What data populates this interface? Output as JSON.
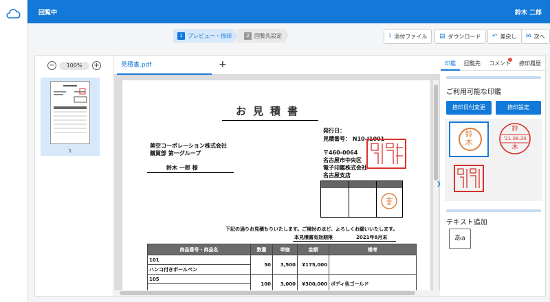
{
  "app": {
    "status_title": "回覧中",
    "user_name": "鈴木 二郎"
  },
  "steps": [
    {
      "num": "1",
      "label": "プレビュー・捺印"
    },
    {
      "num": "2",
      "label": "回覧先設定"
    }
  ],
  "toolbar": {
    "attach": "添付ファイル",
    "download": "ダウンロード",
    "return": "差戻し",
    "next": "次へ"
  },
  "thumbs": {
    "zoom": "100%",
    "page_num": "1"
  },
  "file_tab": "見積書.pdf",
  "document": {
    "title": "お見積書",
    "issue_date": "発行日：",
    "estimate_no": "見積番号： N10-J1001",
    "customer_company": "美空コーポレーション株式会社",
    "customer_dept": "購買部 第一グループ",
    "customer_person": "鈴木 一郎 様",
    "postal": "〒460-0064",
    "address": "名古屋市中央区",
    "vendor_company": "電子印鑑株式会社",
    "vendor_branch": "名古屋支店",
    "intro": "下記の通りお見積もりいたします。ご検討のほど、よろしくお願いいたします。",
    "validity_label": "本見積書有効期限",
    "validity_date": "2021年8月末",
    "table": {
      "headers": [
        "商品番号・商品名",
        "数量",
        "単価",
        "金額",
        "備考"
      ],
      "rows": [
        {
          "code": "101",
          "name": "ハンコ付きボールペン",
          "qty": "50",
          "price": "3,500",
          "amount": "¥175,000",
          "note": ""
        },
        {
          "code": "105",
          "name": "",
          "qty": "100",
          "price": "3,000",
          "amount": "¥300,000",
          "note": "ボディ色ゴールド"
        }
      ]
    }
  },
  "right_panel": {
    "tabs": [
      "印鑑",
      "回覧先",
      "コメント",
      "捺印履歴"
    ],
    "available_title": "ご利用可能な印鑑",
    "date_btn": "捺印日付変更",
    "setting_btn": "捺印設定",
    "stamp_date": "'21.08.20",
    "stamp_surname": "鈴",
    "stamp_given": "木",
    "text_add": "テキスト追加",
    "text_icon": "あa"
  },
  "colors": {
    "accent": "#1379d8",
    "stamp_red": "#d9302b"
  }
}
